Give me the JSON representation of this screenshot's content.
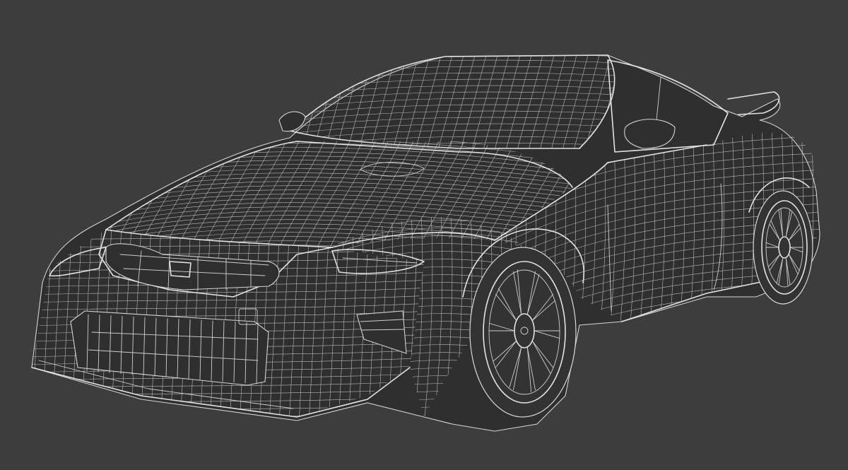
{
  "scene": {
    "subject": "sports-car-wireframe",
    "background_color": "#3d3d3d",
    "wire_color": "#cfcfcf"
  }
}
